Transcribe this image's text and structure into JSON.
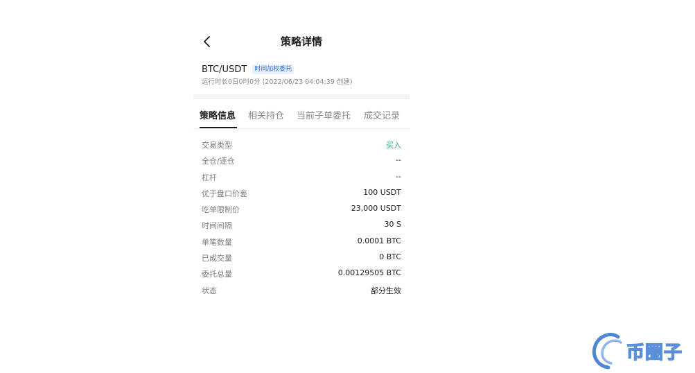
{
  "header": {
    "title": "策略详情"
  },
  "strategy": {
    "pair": "BTC/USDT",
    "type_badge": "时间加权委托",
    "meta": "运行时长0日0时0分 (2022/06/23 04:04:39 创建)"
  },
  "tabs": [
    {
      "label": "策略信息",
      "active": true
    },
    {
      "label": "相关持仓",
      "active": false
    },
    {
      "label": "当前子单委托",
      "active": false
    },
    {
      "label": "成交记录",
      "active": false
    }
  ],
  "details": [
    {
      "label": "交易类型",
      "value": "买入"
    },
    {
      "label": "全仓/逐仓",
      "value": "--"
    },
    {
      "label": "杠杆",
      "value": "--"
    },
    {
      "label": "优于盘口价差",
      "value": "100 USDT"
    },
    {
      "label": "吃单限制价",
      "value": "23,000 USDT"
    },
    {
      "label": "时间间隔",
      "value": "30 S"
    },
    {
      "label": "单笔数量",
      "value": "0.0001 BTC"
    },
    {
      "label": "已成交量",
      "value": "0 BTC"
    },
    {
      "label": "委托总量",
      "value": "0.00129505 BTC"
    },
    {
      "label": "状态",
      "value": "部分生效"
    }
  ],
  "watermark": {
    "text": "币圈子"
  },
  "colors": {
    "buy": "#2eae73",
    "badge": "#2f6fd8",
    "watermark": "#5b8fd9"
  },
  "icons": {
    "back": "chevron-left-icon",
    "logo": "watermark-logo-icon"
  }
}
